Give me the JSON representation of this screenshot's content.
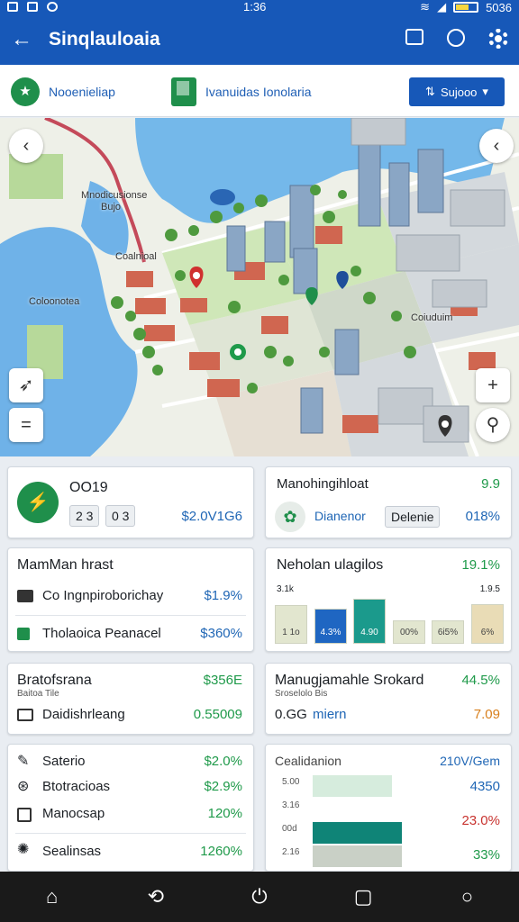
{
  "status": {
    "time": "1:36",
    "battery": "5036"
  },
  "appbar": {
    "title": "Sinqlauloaia"
  },
  "tabs": {
    "tab1_label": "Nooenieliap",
    "tab2_label": "Ivanuidas Ionolaria",
    "dropdown_label": "Sujooo"
  },
  "map": {
    "labels": [
      "Mnodicusionse",
      "Bujo",
      "Coalnioal",
      "Coloonotea",
      "Coiuduim"
    ],
    "icons": {
      "back_left": "chevron-left-icon",
      "back_right": "chevron-left-icon",
      "zoom_in": "plus-icon",
      "compass": "navigation-icon",
      "layers": "menu-icon",
      "locate": "location-pin-icon"
    }
  },
  "card1": {
    "code": "OO19",
    "chip1": "2 3",
    "chip2": "0 3",
    "value": "$2.0V1G6"
  },
  "card2": {
    "title": "Manohingihloat",
    "value_top": "9.9",
    "chip_text": "Dianenor",
    "button": "Delenie",
    "value": "018%"
  },
  "card3": {
    "title": "MamMan hrast",
    "rows": [
      {
        "label": "Co Ingnpiroborichay",
        "value": "$1.9%"
      },
      {
        "label": "Tholaoica Peanacel",
        "value": "$360%"
      }
    ]
  },
  "card4": {
    "title": "Neholan ulagilos",
    "value": "19.1%",
    "subleft": "3.1k",
    "subright": "1.9.5",
    "bar_labels": [
      "1 1o",
      "4.3%",
      "4.90",
      "00%",
      "6i5%",
      "6%"
    ],
    "bar_values": [
      0.8,
      0.72,
      0.92,
      0.48,
      0.48,
      0.82
    ],
    "bar_colors": [
      "#e2e6cf",
      "#1f66c2",
      "#1b9a8c",
      "#e2e6cf",
      "#e2e6cf",
      "#e9dcb6"
    ]
  },
  "card5": {
    "title": "Bratofsrana",
    "subtitle": "Baitoa Tile",
    "value_top": "$356E",
    "row_label": "Daidishrleang",
    "row_value": "0.55009"
  },
  "card6": {
    "title": "Manugjamahle Srokard",
    "subtitle": "Sroselolo Bis",
    "value_top": "44.5%",
    "row_left": "0.GG",
    "row_mid": "miern",
    "row_value": "7.09"
  },
  "card7": {
    "rows": [
      {
        "label": "Saterio",
        "value": "$2.0%"
      },
      {
        "label": "Btotracioas",
        "value": "$2.9%"
      },
      {
        "label": "Manocsap",
        "value": "120%"
      },
      {
        "label": "Sealinsas",
        "value": "1260%"
      }
    ]
  },
  "card8": {
    "title": "Cealidanion",
    "value_top": "210V/Gem",
    "axis_labels": [
      "5.00",
      "3.16",
      "00d",
      "2.16"
    ],
    "bar_values": [
      0.55,
      0.6,
      0.62,
      0.62
    ],
    "bar_colors": [
      "#d6ecdd",
      "#ffffff",
      "#0f8477",
      "#c9d0c6"
    ],
    "values": [
      "4350",
      "23.0%",
      "33%"
    ]
  },
  "nav": [
    "home-icon",
    "back-icon",
    "power-icon",
    "square-icon",
    "circle-icon"
  ]
}
